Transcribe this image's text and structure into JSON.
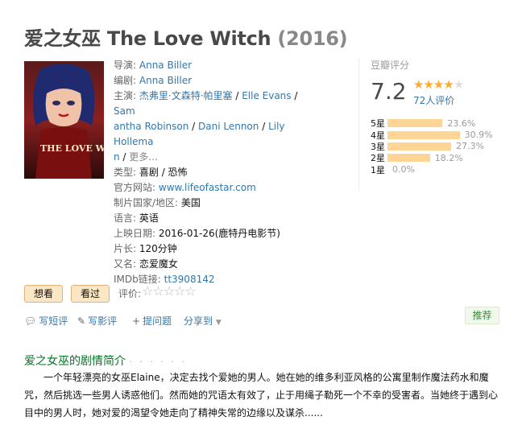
{
  "title": {
    "cn": "爱之女巫",
    "en": "The Love Witch",
    "year": "(2016)"
  },
  "info": {
    "director_label": "导演:",
    "director": "Anna Biller",
    "writer_label": "编剧:",
    "writer": "Anna Biller",
    "cast_label": "主演:",
    "cast_line1": "杰弗里·文森特·帕里塞",
    "cast_line1b": "Elle Evans",
    "cast_line1c": "Sam",
    "cast_line2a": "antha Robinson",
    "cast_line2b": "Dani Lennon",
    "cast_line2c": "Lily Hollema",
    "cast_line3a": "n",
    "cast_more": "更多...",
    "slash": " / ",
    "genre_label": "类型:",
    "genre": "喜剧 / 恐怖",
    "site_label": "官方网站:",
    "site": "www.lifeofastar.com",
    "country_label": "制片国家/地区:",
    "country": "美国",
    "language_label": "语言:",
    "language": "英语",
    "release_label": "上映日期:",
    "release": "2016-01-26(鹿特丹电影节)",
    "runtime_label": "片长:",
    "runtime": "120分钟",
    "aka_label": "又名:",
    "aka": "恋爱魔女",
    "imdb_label": "IMDb链接:",
    "imdb": "tt3908142"
  },
  "rating": {
    "title": "豆瓣评分",
    "score": "7.2",
    "stars_filled": 4,
    "stars_total": 5,
    "count": "72人评价",
    "distribution": [
      {
        "label": "5星",
        "pct": "23.6%",
        "value": 23.6
      },
      {
        "label": "4星",
        "pct": "30.9%",
        "value": 30.9
      },
      {
        "label": "3星",
        "pct": "27.3%",
        "value": 27.3
      },
      {
        "label": "2星",
        "pct": "18.2%",
        "value": 18.2
      },
      {
        "label": "1星",
        "pct": "0.0%",
        "value": 0.0
      }
    ]
  },
  "buttons": {
    "want": "想看",
    "seen": "看过",
    "rate_label": "评价:"
  },
  "actions": {
    "write_short": "写短评",
    "write_review": "写影评",
    "ask": "提问题",
    "share": "分享到"
  },
  "recommend": "推荐",
  "intro": {
    "heading": "爱之女巫的剧情简介",
    "dots": "· · · · · ·",
    "text": "一个年轻漂亮的女巫Elaine，决定去找个爱她的男人。她在她的维多利亚风格的公寓里制作魔法药水和魔咒，然后挑选一些男人诱惑他们。然而她的咒语太有效了，止于用绳子勒死一个不幸的受害者。当她终于遇到心目中的男人时，她对爱的渴望令她走向了精神失常的边缘以及谋杀......"
  },
  "poster": {
    "text": "THE LOVE WITCH"
  },
  "colors": {
    "accent": "#37a",
    "star": "#ffac2d",
    "bar": "#ffd596",
    "intro_heading": "#072"
  }
}
